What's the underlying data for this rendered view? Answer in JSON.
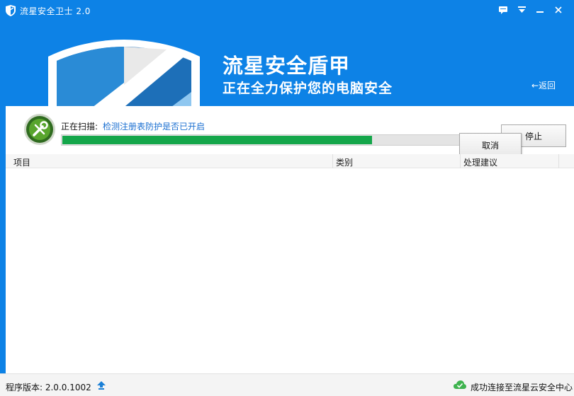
{
  "window": {
    "title": "流星安全卫士 2.0",
    "icons": [
      "app-shield-icon",
      "feedback-icon",
      "menu-icon",
      "minimize-icon",
      "close-icon"
    ]
  },
  "banner": {
    "headline": "流星安全盾甲",
    "subheadline": "正在全力保护您的电脑安全",
    "back_label": "←返回"
  },
  "scan": {
    "label": "正在扫描:",
    "status": "检测注册表防护是否已开启",
    "progress": 0.71,
    "stop_label": "停止",
    "cancel_label": "取消"
  },
  "table": {
    "columns": [
      "项目",
      "类别",
      "处理建议"
    ],
    "rows": []
  },
  "statusbar": {
    "version_label": "程序版本: 2.0.0.1002",
    "cloud_status": "成功连接至流星云安全中心"
  },
  "colors": {
    "primary": "#0d82e6",
    "progress": "#14a64a",
    "link": "#1a6fd1",
    "cloud_ok": "#3fb34f"
  }
}
